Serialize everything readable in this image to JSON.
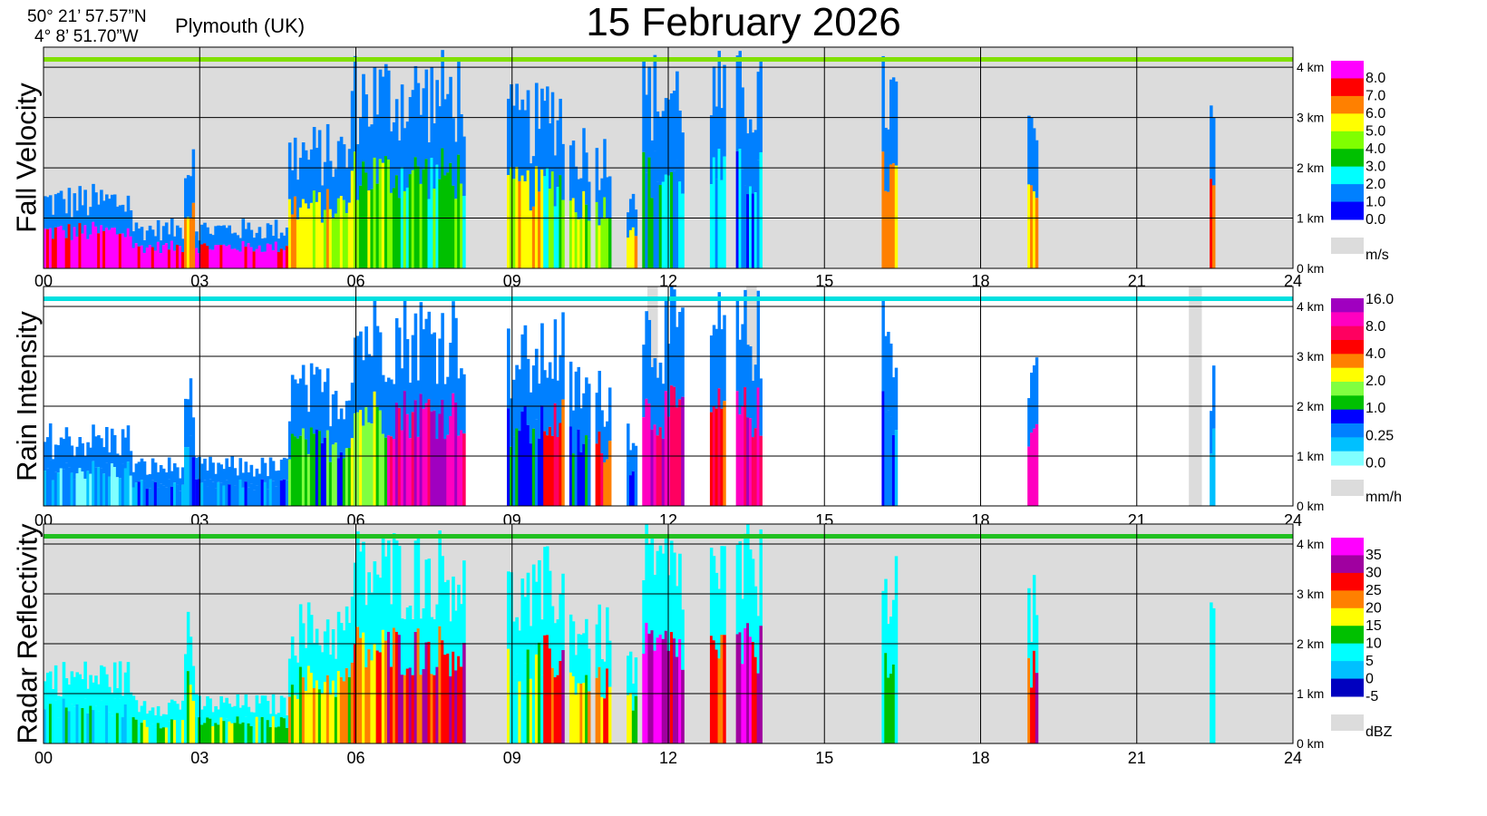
{
  "header": {
    "lat": "50° 21’ 57.57”N",
    "lon": "4°  8’ 51.70”W",
    "location": "Plymouth (UK)",
    "date": "15 February  2026"
  },
  "chart_data": [
    {
      "type": "heatmap",
      "title": "Fall Velocity",
      "unit": "m/s",
      "x_ticks": [
        "00",
        "03",
        "06",
        "09",
        "12",
        "15",
        "18",
        "21",
        "24"
      ],
      "y_ticks": [
        "0 km",
        "1 km",
        "2 km",
        "3 km",
        "4 km"
      ],
      "xlim": [
        0,
        24
      ],
      "ylim": [
        0,
        4.4
      ],
      "colorbar": {
        "labels": [
          "8.0",
          "7.0",
          "6.0",
          "5.0",
          "4.0",
          "3.0",
          "2.0",
          "1.0",
          "0.0"
        ],
        "colors": [
          "#ff00ff",
          "#ff0000",
          "#ff8000",
          "#ffff00",
          "#80ff00",
          "#00c000",
          "#00ffff",
          "#0080ff",
          "#0000ff"
        ],
        "nodata_color": "#dcdcdc"
      },
      "background": "#dcdcdc",
      "strip_color": "#80e000",
      "events": [
        {
          "start": 0.0,
          "end": 1.7,
          "top": 1.7,
          "dominant": 0
        },
        {
          "start": 1.7,
          "end": 4.7,
          "top": 1.0,
          "dominant": 0
        },
        {
          "start": 2.7,
          "end": 2.9,
          "top": 2.7,
          "dominant": 2
        },
        {
          "start": 4.7,
          "end": 5.9,
          "top": 2.9,
          "dominant": 3
        },
        {
          "start": 5.9,
          "end": 6.6,
          "top": 4.4,
          "dominant": 4
        },
        {
          "start": 6.6,
          "end": 8.1,
          "top": 4.4,
          "dominant": 5
        },
        {
          "start": 8.9,
          "end": 9.6,
          "top": 3.7,
          "dominant": 3
        },
        {
          "start": 9.6,
          "end": 10.0,
          "top": 4.0,
          "dominant": 5
        },
        {
          "start": 10.1,
          "end": 10.5,
          "top": 3.0,
          "dominant": 4
        },
        {
          "start": 10.6,
          "end": 10.9,
          "top": 2.8,
          "dominant": 4
        },
        {
          "start": 11.2,
          "end": 11.4,
          "top": 2.0,
          "dominant": 3
        },
        {
          "start": 11.5,
          "end": 12.3,
          "top": 4.4,
          "dominant": 6
        },
        {
          "start": 12.8,
          "end": 13.1,
          "top": 4.4,
          "dominant": 6
        },
        {
          "start": 13.3,
          "end": 13.8,
          "top": 4.4,
          "dominant": 7
        },
        {
          "start": 16.1,
          "end": 16.4,
          "top": 4.3,
          "dominant": 2
        },
        {
          "start": 18.9,
          "end": 19.1,
          "top": 3.4,
          "dominant": 3
        },
        {
          "start": 22.4,
          "end": 22.5,
          "top": 3.3,
          "dominant": 1
        }
      ]
    },
    {
      "type": "heatmap",
      "title": "Rain Intensity",
      "unit": "mm/h",
      "x_ticks": [
        "00",
        "03",
        "06",
        "09",
        "12",
        "15",
        "18",
        "21",
        "24"
      ],
      "y_ticks": [
        "0 km",
        "1 km",
        "2 km",
        "3 km",
        "4 km"
      ],
      "xlim": [
        0,
        24
      ],
      "ylim": [
        0,
        4.4
      ],
      "colorbar": {
        "labels": [
          "16.0",
          "8.0",
          "4.0",
          "2.0",
          "1.0",
          "0.25",
          "0.0"
        ],
        "colors": [
          "#a000c0",
          "#ff00c0",
          "#ff0060",
          "#ff0000",
          "#ff8000",
          "#ffff00",
          "#80ff40",
          "#00c000",
          "#0000ff",
          "#0080ff",
          "#00c0ff",
          "#80ffff"
        ],
        "nodata_color": "#dcdcdc"
      },
      "background": "#ffffff",
      "strip_color": "#00e0e0",
      "events": [
        {
          "start": 0.0,
          "end": 1.7,
          "top": 1.7,
          "dominant": 10
        },
        {
          "start": 1.7,
          "end": 4.7,
          "top": 1.0,
          "dominant": 9
        },
        {
          "start": 2.7,
          "end": 2.9,
          "top": 2.7,
          "dominant": 9
        },
        {
          "start": 4.7,
          "end": 5.9,
          "top": 2.9,
          "dominant": 7
        },
        {
          "start": 5.9,
          "end": 6.6,
          "top": 4.4,
          "dominant": 6
        },
        {
          "start": 6.6,
          "end": 8.1,
          "top": 4.4,
          "dominant": 1
        },
        {
          "start": 8.9,
          "end": 9.6,
          "top": 3.7,
          "dominant": 8
        },
        {
          "start": 9.6,
          "end": 10.0,
          "top": 4.0,
          "dominant": 3
        },
        {
          "start": 10.1,
          "end": 10.5,
          "top": 3.0,
          "dominant": 8
        },
        {
          "start": 10.6,
          "end": 10.9,
          "top": 2.8,
          "dominant": 3
        },
        {
          "start": 11.2,
          "end": 11.4,
          "top": 2.0,
          "dominant": 9
        },
        {
          "start": 11.5,
          "end": 12.3,
          "top": 4.4,
          "dominant": 1
        },
        {
          "start": 12.8,
          "end": 13.1,
          "top": 4.4,
          "dominant": 3
        },
        {
          "start": 13.3,
          "end": 13.8,
          "top": 4.4,
          "dominant": 1
        },
        {
          "start": 16.1,
          "end": 16.4,
          "top": 4.3,
          "dominant": 9
        },
        {
          "start": 18.9,
          "end": 19.1,
          "top": 3.4,
          "dominant": 1
        },
        {
          "start": 22.4,
          "end": 22.5,
          "top": 3.3,
          "dominant": 10
        }
      ],
      "nodata_columns": [
        [
          11.6,
          11.8
        ],
        [
          13.5,
          13.7
        ],
        [
          22.0,
          22.25
        ]
      ]
    },
    {
      "type": "heatmap",
      "title": "Radar Reflectivity",
      "unit": "dBZ",
      "x_ticks": [
        "00",
        "03",
        "06",
        "09",
        "12",
        "15",
        "18",
        "21",
        "24"
      ],
      "y_ticks": [
        "0 km",
        "1 km",
        "2 km",
        "3 km",
        "4 km"
      ],
      "xlim": [
        0,
        24
      ],
      "ylim": [
        0,
        4.4
      ],
      "colorbar": {
        "labels": [
          "35",
          "30",
          "25",
          "20",
          "15",
          "10",
          "5",
          "0",
          "-5"
        ],
        "colors": [
          "#ff00ff",
          "#a000a0",
          "#ff0000",
          "#ff8000",
          "#ffff00",
          "#00c000",
          "#00ffff",
          "#00c0ff",
          "#0000c0"
        ],
        "nodata_color": "#dcdcdc"
      },
      "background": "#dcdcdc",
      "strip_color": "#20c020",
      "events": [
        {
          "start": 0.0,
          "end": 1.7,
          "top": 1.7,
          "dominant": 6
        },
        {
          "start": 1.7,
          "end": 4.7,
          "top": 1.0,
          "dominant": 5
        },
        {
          "start": 2.7,
          "end": 2.9,
          "top": 2.7,
          "dominant": 5
        },
        {
          "start": 4.7,
          "end": 5.9,
          "top": 2.9,
          "dominant": 4
        },
        {
          "start": 5.9,
          "end": 6.6,
          "top": 4.4,
          "dominant": 3
        },
        {
          "start": 6.6,
          "end": 8.1,
          "top": 4.4,
          "dominant": 2
        },
        {
          "start": 8.9,
          "end": 9.6,
          "top": 3.7,
          "dominant": 5
        },
        {
          "start": 9.6,
          "end": 10.0,
          "top": 4.0,
          "dominant": 2
        },
        {
          "start": 10.1,
          "end": 10.5,
          "top": 3.0,
          "dominant": 4
        },
        {
          "start": 10.6,
          "end": 10.9,
          "top": 2.8,
          "dominant": 3
        },
        {
          "start": 11.2,
          "end": 11.4,
          "top": 2.0,
          "dominant": 5
        },
        {
          "start": 11.5,
          "end": 12.3,
          "top": 4.4,
          "dominant": 1
        },
        {
          "start": 12.8,
          "end": 13.1,
          "top": 4.4,
          "dominant": 2
        },
        {
          "start": 13.3,
          "end": 13.8,
          "top": 4.4,
          "dominant": 1
        },
        {
          "start": 16.1,
          "end": 16.4,
          "top": 4.3,
          "dominant": 5
        },
        {
          "start": 18.9,
          "end": 19.1,
          "top": 3.4,
          "dominant": 2
        },
        {
          "start": 22.4,
          "end": 22.5,
          "top": 3.3,
          "dominant": 6
        }
      ]
    }
  ]
}
